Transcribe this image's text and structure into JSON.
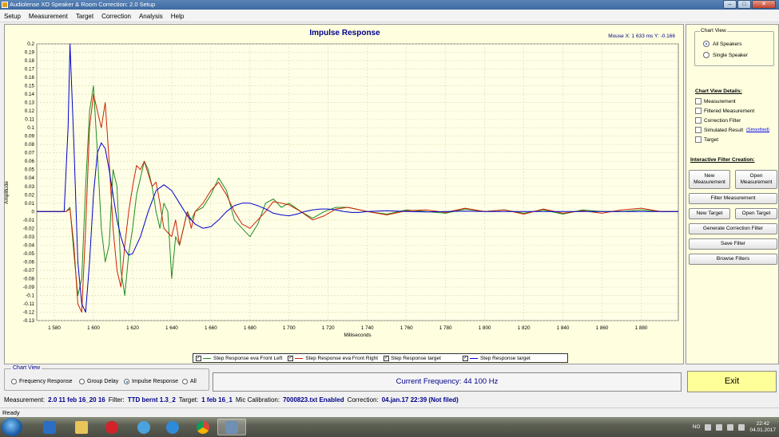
{
  "window": {
    "title": "Audiolense XO Speaker & Room Correction: 2.0 Setup",
    "buttons": [
      "–",
      "□",
      "✕"
    ]
  },
  "menu": [
    "Setup",
    "Measurement",
    "Target",
    "Correction",
    "Analysis",
    "Help"
  ],
  "mouse_readout": "Mouse X: 1 633 ms   Y: -0.166",
  "chart_data": {
    "type": "line",
    "title": "Impulse Response",
    "xlabel": "Milliseconds",
    "ylabel": "Amplitude",
    "xlim": [
      1571,
      1899
    ],
    "ylim": [
      -0.13,
      0.2
    ],
    "xticks": [
      1580,
      1600,
      1620,
      1640,
      1660,
      1680,
      1700,
      1720,
      1740,
      1760,
      1780,
      1800,
      1820,
      1840,
      1860,
      1880
    ],
    "xtick_labels": [
      "1 580",
      "1 600",
      "1 620",
      "1 640",
      "1 660",
      "1 680",
      "1 700",
      "1 720",
      "1 740",
      "1 760",
      "1 780",
      "1 800",
      "1 820",
      "1 840",
      "1 860",
      "1 880"
    ],
    "yticks": [
      0.2,
      0.19,
      0.18,
      0.17,
      0.16,
      0.15,
      0.14,
      0.13,
      0.12,
      0.11,
      0.1,
      0.09,
      0.08,
      0.07,
      0.06,
      0.05,
      0.04,
      0.03,
      0.02,
      0.01,
      0,
      -0.01,
      -0.02,
      -0.03,
      -0.04,
      -0.05,
      -0.06,
      -0.07,
      -0.08,
      -0.09,
      -0.1,
      -0.11,
      -0.12,
      -0.13
    ],
    "ytick_labels": [
      "0.2",
      "0.19",
      "0.18",
      "0.17",
      "0.16",
      "0.15",
      "0.14",
      "0.13",
      "0.12",
      "0.11",
      "0.1",
      "0.09",
      "0.08",
      "0.07",
      "0.06",
      "0.05",
      "0.04",
      "0.03",
      "0.02",
      "0.01",
      "0",
      "-0.01",
      "-0.02",
      "-0.03",
      "-0.04",
      "-0.05",
      "-0.06",
      "-0.07",
      "-0.08",
      "-0.09",
      "-0.1",
      "-0.11",
      "-0.12",
      "-0.13"
    ],
    "grid": true,
    "series": [
      {
        "name": "Step Response eva Front Left",
        "color": "#228b22",
        "x": [
          1571,
          1580,
          1586,
          1588,
          1590,
          1592,
          1594,
          1596,
          1598,
          1600,
          1602,
          1604,
          1606,
          1608,
          1610,
          1612,
          1614,
          1616,
          1618,
          1620,
          1622,
          1624,
          1626,
          1628,
          1630,
          1632,
          1634,
          1636,
          1638,
          1640,
          1642,
          1644,
          1646,
          1648,
          1650,
          1652,
          1656,
          1660,
          1664,
          1668,
          1672,
          1676,
          1680,
          1684,
          1688,
          1692,
          1696,
          1700,
          1706,
          1712,
          1718,
          1724,
          1730,
          1740,
          1750,
          1760,
          1770,
          1780,
          1790,
          1800,
          1810,
          1820,
          1830,
          1840,
          1850,
          1860,
          1870,
          1880,
          1890,
          1899
        ],
        "y": [
          0.0,
          0.0,
          0.0,
          0.005,
          -0.05,
          -0.1,
          -0.08,
          0.03,
          0.12,
          0.15,
          0.07,
          -0.02,
          -0.06,
          -0.04,
          0.05,
          0.03,
          -0.07,
          -0.1,
          -0.05,
          -0.02,
          0.02,
          0.04,
          0.06,
          0.05,
          0.03,
          0.0,
          -0.02,
          0.01,
          0.0,
          -0.08,
          -0.03,
          -0.04,
          -0.02,
          0.0,
          -0.01,
          0.0,
          0.005,
          0.02,
          0.04,
          0.025,
          -0.01,
          -0.02,
          -0.03,
          -0.015,
          0.01,
          0.015,
          0.005,
          0.01,
          0.0,
          -0.008,
          0.0,
          0.005,
          0.005,
          0.0,
          -0.003,
          0.002,
          0.0,
          -0.002,
          0.003,
          0.0,
          0.002,
          -0.002,
          0.002,
          -0.003,
          0.002,
          0.0,
          0.0,
          0.002,
          0.0,
          0.0
        ]
      },
      {
        "name": "Step Response eva Front Right",
        "color": "#cc2200",
        "x": [
          1571,
          1580,
          1586,
          1588,
          1590,
          1592,
          1594,
          1596,
          1598,
          1600,
          1602,
          1604,
          1606,
          1608,
          1610,
          1612,
          1614,
          1616,
          1618,
          1620,
          1622,
          1624,
          1626,
          1628,
          1630,
          1632,
          1634,
          1636,
          1638,
          1640,
          1642,
          1644,
          1646,
          1648,
          1650,
          1652,
          1656,
          1660,
          1664,
          1668,
          1672,
          1676,
          1680,
          1684,
          1688,
          1692,
          1696,
          1700,
          1706,
          1712,
          1718,
          1724,
          1730,
          1740,
          1750,
          1760,
          1770,
          1780,
          1790,
          1800,
          1810,
          1820,
          1830,
          1840,
          1850,
          1860,
          1870,
          1880,
          1890,
          1899
        ],
        "y": [
          0.0,
          0.0,
          0.0,
          0.003,
          -0.04,
          -0.11,
          -0.12,
          -0.02,
          0.1,
          0.14,
          0.12,
          0.1,
          0.13,
          0.06,
          -0.02,
          -0.07,
          -0.09,
          -0.04,
          0.0,
          0.03,
          0.055,
          0.05,
          0.06,
          0.045,
          0.03,
          0.035,
          0.01,
          -0.02,
          -0.025,
          -0.03,
          -0.01,
          -0.04,
          -0.02,
          0.0,
          -0.02,
          0.0,
          0.01,
          0.025,
          0.035,
          0.02,
          0.0,
          -0.015,
          -0.02,
          -0.01,
          0.0,
          0.012,
          0.01,
          0.008,
          0.0,
          -0.01,
          -0.005,
          0.003,
          0.005,
          0.0,
          -0.004,
          0.001,
          0.002,
          -0.001,
          0.004,
          0.0,
          0.002,
          -0.003,
          0.003,
          -0.002,
          0.001,
          -0.002,
          0.002,
          0.004,
          0.0,
          0.0
        ]
      },
      {
        "name": "Step Response target",
        "color": "#0000cc",
        "x": [
          1571,
          1580,
          1585,
          1587,
          1588,
          1590,
          1592,
          1594,
          1596,
          1598,
          1600,
          1602,
          1604,
          1606,
          1608,
          1610,
          1612,
          1614,
          1616,
          1618,
          1620,
          1624,
          1628,
          1632,
          1636,
          1640,
          1644,
          1648,
          1652,
          1656,
          1660,
          1664,
          1668,
          1672,
          1676,
          1680,
          1684,
          1688,
          1692,
          1696,
          1700,
          1704,
          1708,
          1712,
          1716,
          1720,
          1724,
          1728,
          1732,
          1736,
          1740,
          1750,
          1760,
          1770,
          1780,
          1790,
          1800,
          1810,
          1820,
          1830,
          1840,
          1850,
          1860,
          1870,
          1880,
          1890,
          1899
        ],
        "y": [
          0.0,
          0.0,
          0.0,
          0.1,
          0.2,
          0.08,
          -0.06,
          -0.11,
          -0.12,
          -0.06,
          0.02,
          0.07,
          0.082,
          0.075,
          0.05,
          0.02,
          -0.01,
          -0.03,
          -0.045,
          -0.052,
          -0.05,
          -0.03,
          0.0,
          0.025,
          0.032,
          0.025,
          0.01,
          -0.005,
          -0.015,
          -0.02,
          -0.018,
          -0.01,
          0.0,
          0.007,
          0.01,
          0.01,
          0.007,
          0.003,
          -0.002,
          -0.004,
          -0.005,
          -0.003,
          0.0,
          0.002,
          0.003,
          0.003,
          0.002,
          0.0,
          -0.001,
          -0.001,
          0.0,
          0.001,
          0.0,
          -0.0005,
          0.0,
          0.0005,
          0.0,
          0.0,
          0.0,
          0.0,
          0.0,
          0.0,
          0.0,
          0.0,
          0.0,
          0.0,
          0.0
        ]
      }
    ]
  },
  "legend": [
    {
      "label": "Step Response eva Front Left",
      "checked": true
    },
    {
      "label": "Step Response eva Front Right",
      "checked": true
    },
    {
      "label": "Step Response target",
      "checked": true
    },
    {
      "label": "Step Response target",
      "checked": true
    }
  ],
  "right_panel": {
    "chart_view_title": "Chart View",
    "all_speakers": "All Speakers",
    "single_speaker": "Single Speaker",
    "details_title": "Chart View Details:",
    "details": [
      "Measurement",
      "Filtered Measurement",
      "Correction Filter",
      "Simulated Result",
      "Target"
    ],
    "smoothed_link": "(Smoothed)",
    "filter_title": "Interactive Filter Creation:",
    "new_measurement": "New Measurement",
    "open_measurement": "Open Measurement",
    "filter_measurement": "Filter Measurement",
    "new_target": "New Target",
    "open_target": "Open Target",
    "generate_filter": "Generate Correction Filter",
    "save_filter": "Save Filter",
    "browse_filters": "Browse Filters"
  },
  "bottom_chart_view": {
    "title": "Chart View",
    "options": [
      "Frequency Response",
      "Group Delay",
      "Impulse Response",
      "All"
    ],
    "selected": "Impulse Response"
  },
  "current_frequency": "Current Frequency: 44 100 Hz",
  "exit_label": "Exit",
  "status": {
    "measurement_label": "Measurement:",
    "measurement_value": "2.0 11 feb 16_20 16",
    "filter_label": "Filter:",
    "filter_value": "TTD bernt 1.3_2",
    "target_label": "Target:",
    "target_value": "1 feb 16_1",
    "mic_label": "Mic Calibration:",
    "mic_value": "7000823.txt Enabled",
    "correction_label": "Correction:",
    "correction_value": "04.jan.17 22:39 (Not filed)"
  },
  "ready_text": "Ready",
  "taskbar": {
    "lang": "NO",
    "time": "22:42",
    "date": "04.01.2017"
  }
}
